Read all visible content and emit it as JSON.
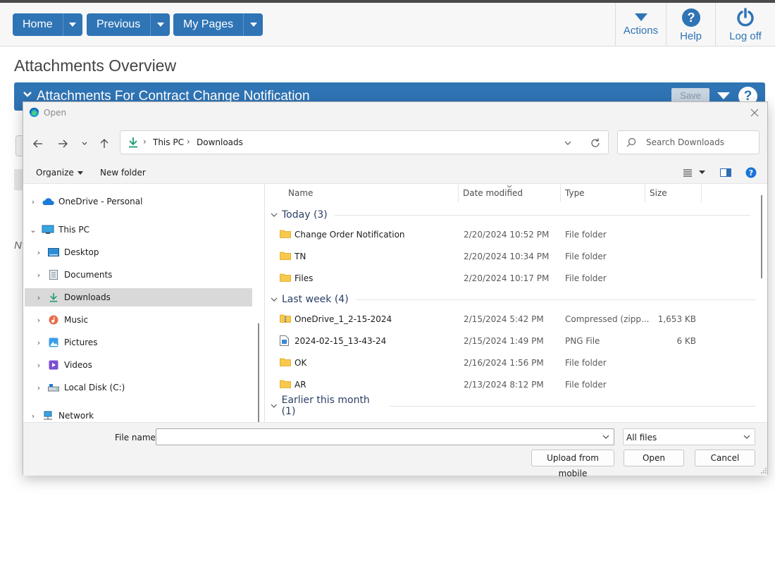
{
  "app": {
    "nav": {
      "home_label": "Home",
      "previous_label": "Previous",
      "mypages_label": "My Pages"
    },
    "top_actions": {
      "actions_label": "Actions",
      "help_label": "Help",
      "logoff_label": "Log off"
    },
    "page_title": "Attachments Overview",
    "panel": {
      "title": "Attachments For Contract Change Notification",
      "save_label": "Save",
      "help_glyph": "?"
    },
    "background_fragment": "N",
    "colors": {
      "brand": "#2f74b5",
      "selected_row": "#d9d9d9"
    }
  },
  "dialog": {
    "title": "Open",
    "address": {
      "segments": [
        "This PC",
        "Downloads"
      ]
    },
    "search_placeholder": "Search Downloads",
    "toolbar": {
      "organize_label": "Organize",
      "new_folder_label": "New folder"
    },
    "nav_pane": [
      {
        "label": "OneDrive - Personal",
        "icon": "onedrive-icon",
        "expanded": false
      },
      {
        "label": "This PC",
        "icon": "pc-icon",
        "expanded": true
      },
      {
        "label": "Desktop",
        "icon": "desktop-icon",
        "expanded": false
      },
      {
        "label": "Documents",
        "icon": "documents-icon",
        "expanded": false
      },
      {
        "label": "Downloads",
        "icon": "downloads-icon",
        "expanded": false,
        "selected": true
      },
      {
        "label": "Music",
        "icon": "music-icon",
        "expanded": false
      },
      {
        "label": "Pictures",
        "icon": "pictures-icon",
        "expanded": false
      },
      {
        "label": "Videos",
        "icon": "videos-icon",
        "expanded": false
      },
      {
        "label": "Local Disk (C:)",
        "icon": "disk-icon",
        "expanded": false
      },
      {
        "label": "Network",
        "icon": "network-icon",
        "expanded": false
      }
    ],
    "columns": {
      "name": "Name",
      "date": "Date modified",
      "type": "Type",
      "size": "Size"
    },
    "groups": [
      {
        "label": "Today (3)",
        "files": [
          {
            "name": "Change Order Notification",
            "date": "2/20/2024 10:52 PM",
            "type": "File folder",
            "size": "",
            "icon": "folder-icon"
          },
          {
            "name": "TN",
            "date": "2/20/2024 10:34 PM",
            "type": "File folder",
            "size": "",
            "icon": "folder-icon"
          },
          {
            "name": "Files",
            "date": "2/20/2024 10:17 PM",
            "type": "File folder",
            "size": "",
            "icon": "folder-icon"
          }
        ]
      },
      {
        "label": "Last week (4)",
        "files": [
          {
            "name": "OneDrive_1_2-15-2024",
            "date": "2/15/2024 5:42 PM",
            "type": "Compressed (zipp...",
            "size": "1,653 KB",
            "icon": "zip-folder-icon"
          },
          {
            "name": "2024-02-15_13-43-24",
            "date": "2/15/2024 1:49 PM",
            "type": "PNG File",
            "size": "6 KB",
            "icon": "png-file-icon"
          },
          {
            "name": "OK",
            "date": "2/16/2024 1:56 PM",
            "type": "File folder",
            "size": "",
            "icon": "folder-icon"
          },
          {
            "name": "AR",
            "date": "2/13/2024 8:12 PM",
            "type": "File folder",
            "size": "",
            "icon": "folder-icon"
          }
        ]
      },
      {
        "label": "Earlier this month (1)",
        "files": []
      }
    ],
    "file_name_label": "File name:",
    "file_name_value": "",
    "filter_value": "All files",
    "buttons": {
      "upload_label": "Upload from mobile",
      "open_label": "Open",
      "cancel_label": "Cancel"
    }
  }
}
